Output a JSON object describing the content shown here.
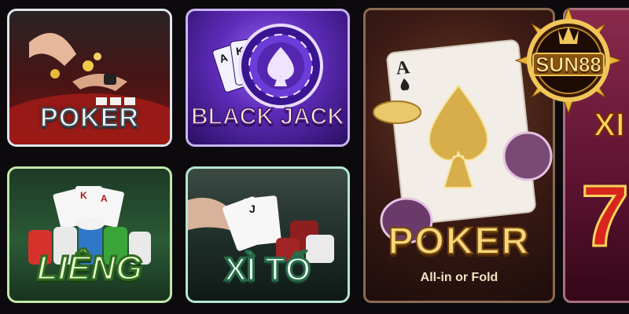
{
  "games": [
    {
      "id": "poker",
      "label": "POKER"
    },
    {
      "id": "blackjack",
      "label": "BLACK JACK"
    },
    {
      "id": "lieng",
      "label": "LIÊNG"
    },
    {
      "id": "xito",
      "label": "XÌ TỐ"
    },
    {
      "id": "poker-featured",
      "label": "POKER",
      "subtitle": "All-in or Fold"
    },
    {
      "id": "partial",
      "label": "XI"
    }
  ],
  "logo": {
    "text": "SUN88"
  },
  "icons": [
    "spade-icon",
    "chip-icon",
    "playing-card-icon",
    "logo-sun-icon"
  ],
  "colors": {
    "gold": "#f7d77a",
    "purple": "#5e2bb8",
    "green": "#2b5a36",
    "red": "#7c1512"
  }
}
